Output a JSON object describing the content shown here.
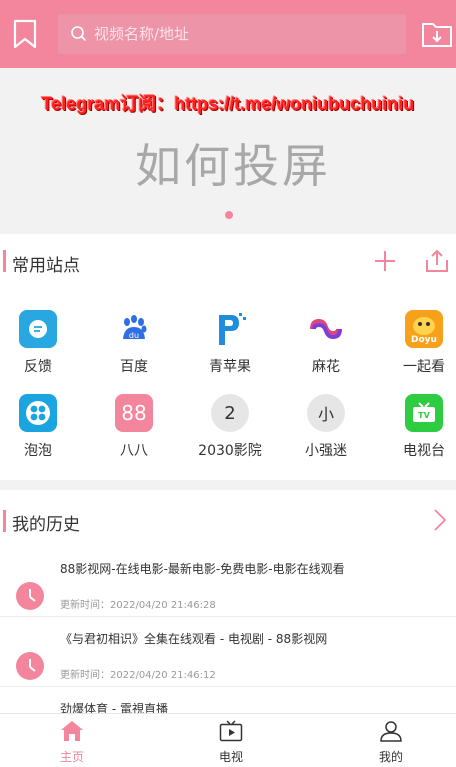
{
  "header": {
    "search_placeholder": "视频名称/地址",
    "bookmark_icon": "bookmark-icon",
    "download_icon": "folder-download-icon"
  },
  "banner": {
    "telegram_text": "Telegram订阅：https://t.me/woniubuchuiniu",
    "title": "如何投屏"
  },
  "sites": {
    "title": "常用站点",
    "items": [
      {
        "label": "反馈",
        "icon": "chat-icon",
        "color": "#29a7e1"
      },
      {
        "label": "百度",
        "icon": "baidu-paw-icon",
        "color": "#2f6ee5"
      },
      {
        "label": "青苹果",
        "icon": "qingpingguo-icon",
        "color": "#1f8ddb"
      },
      {
        "label": "麻花",
        "icon": "mahua-icon",
        "color": "#e0457b"
      },
      {
        "label": "一起看",
        "icon": "doyu-icon",
        "color": "#f7a11a"
      },
      {
        "label": "泡泡",
        "icon": "paopao-icon",
        "color": "#1ba5e0"
      },
      {
        "label": "八八",
        "icon_text": "88",
        "color": "#f3859d"
      },
      {
        "label": "2030影院",
        "icon_text": "2",
        "color": "#e6e6e6"
      },
      {
        "label": "小强迷",
        "icon_text": "小",
        "color": "#e6e6e6"
      },
      {
        "label": "电视台",
        "icon": "tv-icon",
        "color": "#2ecc40"
      }
    ]
  },
  "history": {
    "title": "我的历史",
    "items": [
      {
        "title": "88影视网-在线电影-最新电影-免费电影-电影在线观看",
        "time": "更新时间：2022/04/20 21:46:28"
      },
      {
        "title": "《与君初相识》全集在线观看 - 电视剧 - 88影视网",
        "time": "更新时间：2022/04/20 21:46:12"
      },
      {
        "title": "劲爆体育 - 電視直播",
        "time": ""
      }
    ]
  },
  "nav": {
    "items": [
      {
        "label": "主页",
        "icon": "home-icon",
        "active": true
      },
      {
        "label": "电视",
        "icon": "tv-play-icon",
        "active": false
      },
      {
        "label": "我的",
        "icon": "user-icon",
        "active": false
      }
    ]
  },
  "colors": {
    "accent": "#f3859d"
  }
}
